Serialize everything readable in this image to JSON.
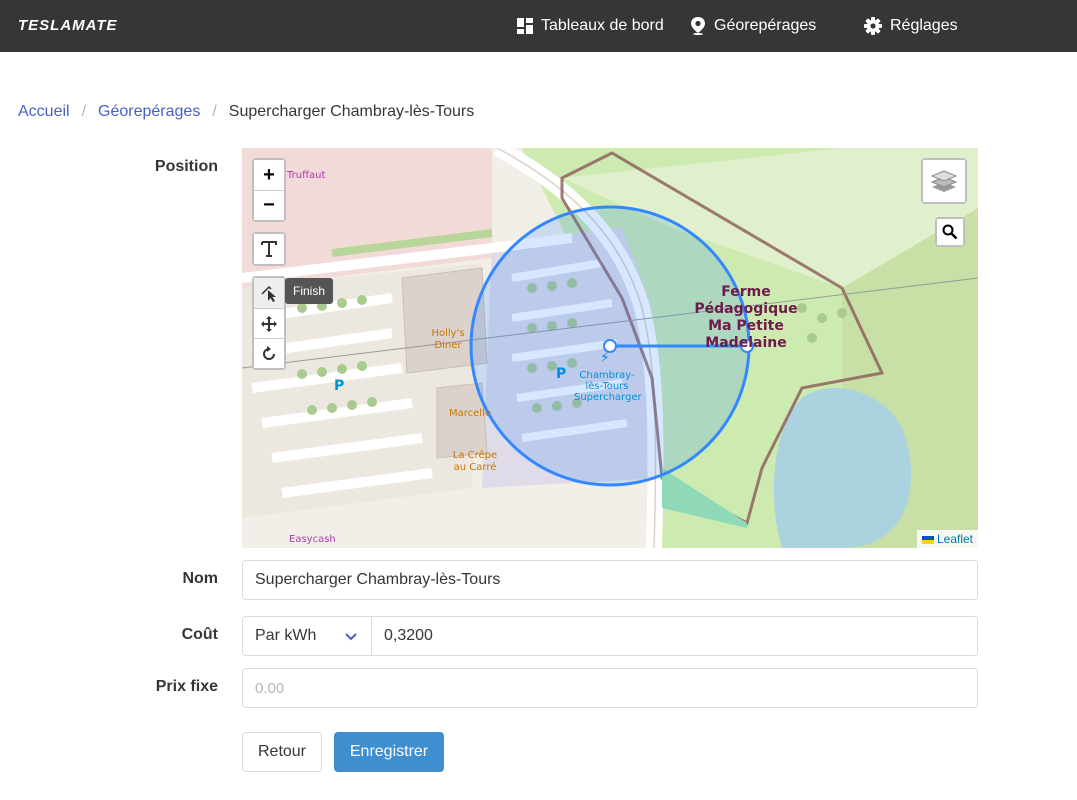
{
  "app": {
    "brand": "TESLAMATE"
  },
  "nav": {
    "dashboards": "Tableaux de bord",
    "geofences": "Géorepérages",
    "settings": "Réglages"
  },
  "breadcrumb": {
    "home": "Accueil",
    "geofences": "Géorepérages",
    "current": "Supercharger Chambray-lès-Tours"
  },
  "form": {
    "position_label": "Position",
    "name_label": "Nom",
    "name_value": "Supercharger Chambray-lès-Tours",
    "cost_label": "Coût",
    "cost_mode": "Par kWh",
    "cost_value": "0,3200",
    "fixed_label": "Prix fixe",
    "fixed_placeholder": "0.00"
  },
  "map": {
    "zoom_in": "+",
    "zoom_out": "−",
    "finish_tooltip": "Finish",
    "attribution": "Leaflet",
    "labels": {
      "truffaut": "Truffaut",
      "hollys": "Holly's Diner",
      "marcello": "Marcello",
      "crepe": "La Crêpe au Carré",
      "easycash": "Easycash",
      "supercharger": "Chambray-lès-Tours Supercharger",
      "ferme": "Ferme Pédagogique Ma Petite Madelaine"
    },
    "circle_color": "#3388ff"
  },
  "buttons": {
    "back": "Retour",
    "save": "Enregistrer"
  },
  "colors": {
    "navbar": "#363636",
    "link": "#485fc7",
    "primary": "#3e8ed0"
  }
}
